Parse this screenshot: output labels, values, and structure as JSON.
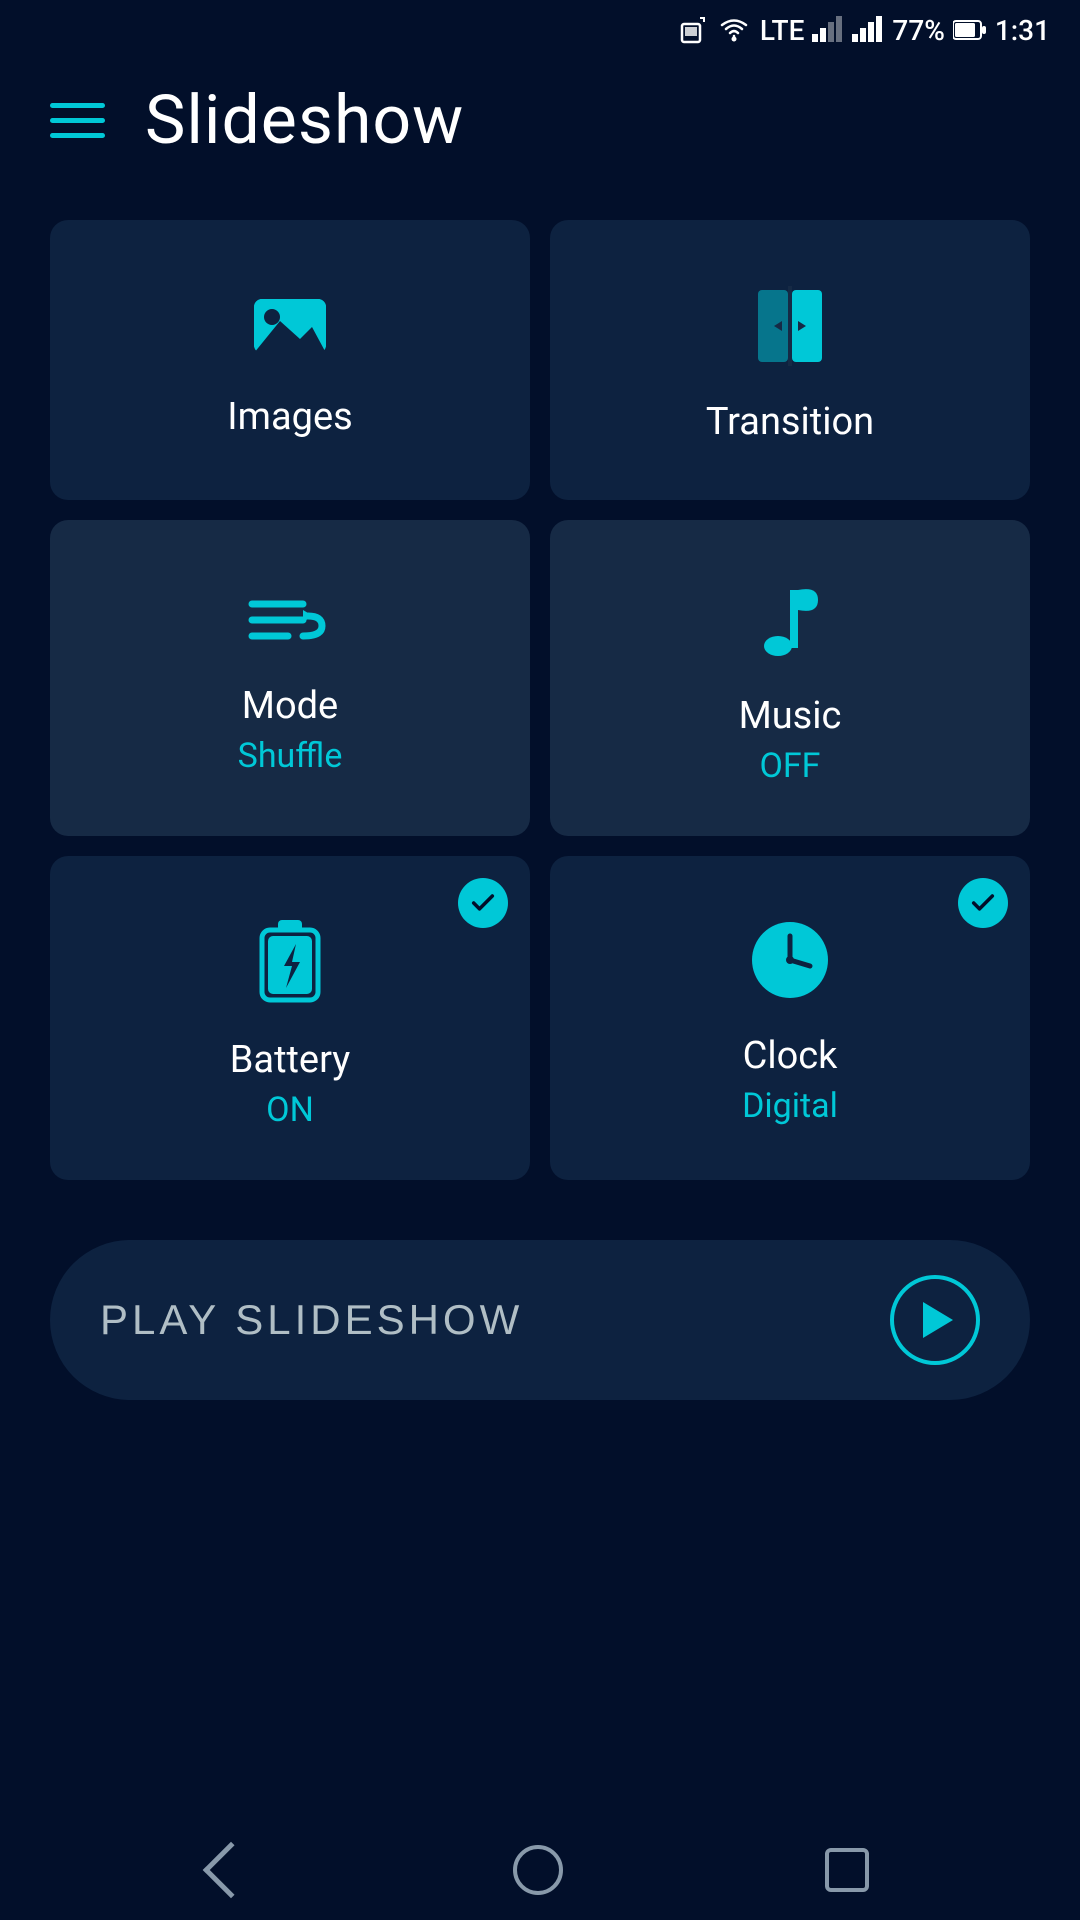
{
  "statusBar": {
    "battery": "77%",
    "time": "1:31",
    "signal": "LTE"
  },
  "header": {
    "title": "Slideshow"
  },
  "cards": [
    {
      "id": "images",
      "label": "Images",
      "sublabel": null,
      "hasCheck": false,
      "lighter": false
    },
    {
      "id": "transition",
      "label": "Transition",
      "sublabel": null,
      "hasCheck": false,
      "lighter": false
    },
    {
      "id": "mode",
      "label": "Mode",
      "sublabel": "Shuffle",
      "hasCheck": false,
      "lighter": true
    },
    {
      "id": "music",
      "label": "Music",
      "sublabel": "OFF",
      "hasCheck": false,
      "lighter": true
    },
    {
      "id": "battery",
      "label": "Battery",
      "sublabel": "ON",
      "hasCheck": true,
      "lighter": false
    },
    {
      "id": "clock",
      "label": "Clock",
      "sublabel": "Digital",
      "hasCheck": true,
      "lighter": false
    }
  ],
  "playButton": {
    "label": "PLAY SLIDESHOW"
  },
  "nav": {
    "back": "back",
    "home": "home",
    "recent": "recent"
  }
}
